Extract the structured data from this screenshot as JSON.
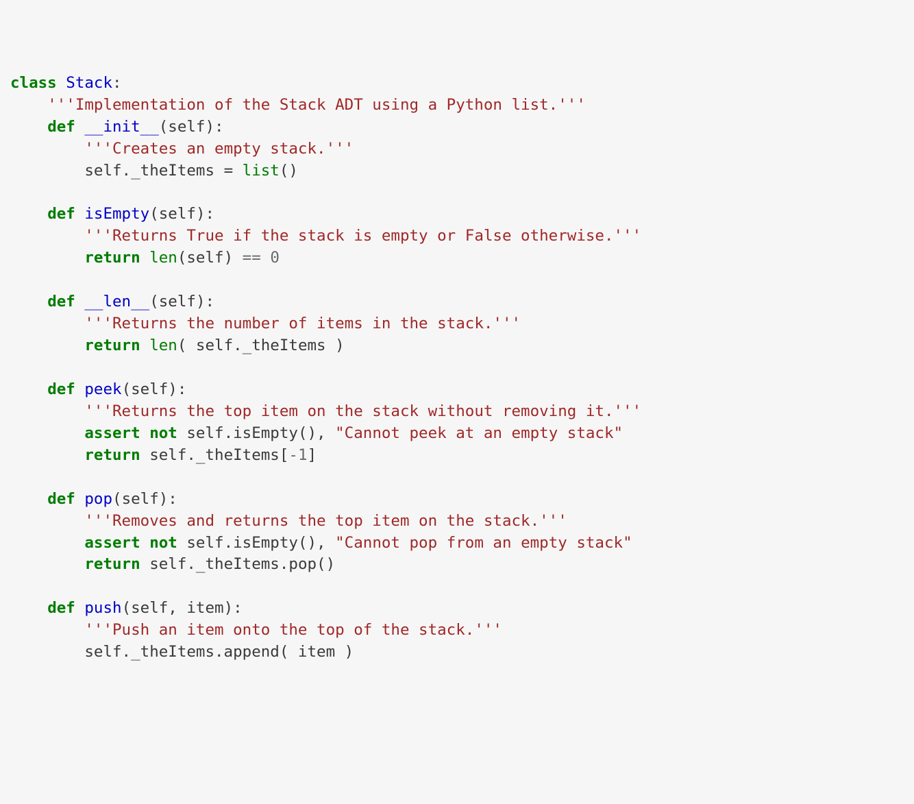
{
  "code": {
    "lines": [
      [
        {
          "cls": "kw",
          "t": "class"
        },
        {
          "cls": "id",
          "t": " "
        },
        {
          "cls": "cls",
          "t": "Stack"
        },
        {
          "cls": "pun",
          "t": ":"
        }
      ],
      [
        {
          "cls": "id",
          "t": "    "
        },
        {
          "cls": "str",
          "t": "'''Implementation of the Stack ADT using a Python list.'''"
        }
      ],
      [
        {
          "cls": "id",
          "t": "    "
        },
        {
          "cls": "kw",
          "t": "def"
        },
        {
          "cls": "id",
          "t": " "
        },
        {
          "cls": "fn",
          "t": "__init__"
        },
        {
          "cls": "pun",
          "t": "("
        },
        {
          "cls": "id",
          "t": "self"
        },
        {
          "cls": "pun",
          "t": "):"
        }
      ],
      [
        {
          "cls": "id",
          "t": "        "
        },
        {
          "cls": "str",
          "t": "'''Creates an empty stack.'''"
        }
      ],
      [
        {
          "cls": "id",
          "t": "        self._theItems "
        },
        {
          "cls": "pun",
          "t": "="
        },
        {
          "cls": "id",
          "t": " "
        },
        {
          "cls": "bi",
          "t": "list"
        },
        {
          "cls": "pun",
          "t": "()"
        }
      ],
      [
        {
          "cls": "id",
          "t": ""
        }
      ],
      [
        {
          "cls": "id",
          "t": "    "
        },
        {
          "cls": "kw",
          "t": "def"
        },
        {
          "cls": "id",
          "t": " "
        },
        {
          "cls": "fn",
          "t": "isEmpty"
        },
        {
          "cls": "pun",
          "t": "("
        },
        {
          "cls": "id",
          "t": "self"
        },
        {
          "cls": "pun",
          "t": "):"
        }
      ],
      [
        {
          "cls": "id",
          "t": "        "
        },
        {
          "cls": "str",
          "t": "'''Returns True if the stack is empty or False otherwise.'''"
        }
      ],
      [
        {
          "cls": "id",
          "t": "        "
        },
        {
          "cls": "kw",
          "t": "return"
        },
        {
          "cls": "id",
          "t": " "
        },
        {
          "cls": "bi",
          "t": "len"
        },
        {
          "cls": "pun",
          "t": "("
        },
        {
          "cls": "id",
          "t": "self"
        },
        {
          "cls": "pun",
          "t": ") "
        },
        {
          "cls": "op",
          "t": "=="
        },
        {
          "cls": "id",
          "t": " "
        },
        {
          "cls": "num",
          "t": "0"
        }
      ],
      [
        {
          "cls": "id",
          "t": ""
        }
      ],
      [
        {
          "cls": "id",
          "t": "    "
        },
        {
          "cls": "kw",
          "t": "def"
        },
        {
          "cls": "id",
          "t": " "
        },
        {
          "cls": "fn",
          "t": "__len__"
        },
        {
          "cls": "pun",
          "t": "("
        },
        {
          "cls": "id",
          "t": "self"
        },
        {
          "cls": "pun",
          "t": "):"
        }
      ],
      [
        {
          "cls": "id",
          "t": "        "
        },
        {
          "cls": "str",
          "t": "'''Returns the number of items in the stack.'''"
        }
      ],
      [
        {
          "cls": "id",
          "t": "        "
        },
        {
          "cls": "kw",
          "t": "return"
        },
        {
          "cls": "id",
          "t": " "
        },
        {
          "cls": "bi",
          "t": "len"
        },
        {
          "cls": "pun",
          "t": "("
        },
        {
          "cls": "id",
          "t": " self._theItems "
        },
        {
          "cls": "pun",
          "t": ")"
        }
      ],
      [
        {
          "cls": "id",
          "t": ""
        }
      ],
      [
        {
          "cls": "id",
          "t": "    "
        },
        {
          "cls": "kw",
          "t": "def"
        },
        {
          "cls": "id",
          "t": " "
        },
        {
          "cls": "fn",
          "t": "peek"
        },
        {
          "cls": "pun",
          "t": "("
        },
        {
          "cls": "id",
          "t": "self"
        },
        {
          "cls": "pun",
          "t": "):"
        }
      ],
      [
        {
          "cls": "id",
          "t": "        "
        },
        {
          "cls": "str",
          "t": "'''Returns the top item on the stack without removing it.'''"
        }
      ],
      [
        {
          "cls": "id",
          "t": "        "
        },
        {
          "cls": "kw",
          "t": "assert"
        },
        {
          "cls": "id",
          "t": " "
        },
        {
          "cls": "kw",
          "t": "not"
        },
        {
          "cls": "id",
          "t": " self.isEmpty"
        },
        {
          "cls": "pun",
          "t": "(), "
        },
        {
          "cls": "str",
          "t": "\"Cannot peek at an empty stack\""
        }
      ],
      [
        {
          "cls": "id",
          "t": "        "
        },
        {
          "cls": "kw",
          "t": "return"
        },
        {
          "cls": "id",
          "t": " self._theItems"
        },
        {
          "cls": "pun",
          "t": "["
        },
        {
          "cls": "op",
          "t": "-"
        },
        {
          "cls": "num",
          "t": "1"
        },
        {
          "cls": "pun",
          "t": "]"
        }
      ],
      [
        {
          "cls": "id",
          "t": ""
        }
      ],
      [
        {
          "cls": "id",
          "t": "    "
        },
        {
          "cls": "kw",
          "t": "def"
        },
        {
          "cls": "id",
          "t": " "
        },
        {
          "cls": "fn",
          "t": "pop"
        },
        {
          "cls": "pun",
          "t": "("
        },
        {
          "cls": "id",
          "t": "self"
        },
        {
          "cls": "pun",
          "t": "):"
        }
      ],
      [
        {
          "cls": "id",
          "t": "        "
        },
        {
          "cls": "str",
          "t": "'''Removes and returns the top item on the stack.'''"
        }
      ],
      [
        {
          "cls": "id",
          "t": "        "
        },
        {
          "cls": "kw",
          "t": "assert"
        },
        {
          "cls": "id",
          "t": " "
        },
        {
          "cls": "kw",
          "t": "not"
        },
        {
          "cls": "id",
          "t": " self.isEmpty"
        },
        {
          "cls": "pun",
          "t": "(), "
        },
        {
          "cls": "str",
          "t": "\"Cannot pop from an empty stack\""
        }
      ],
      [
        {
          "cls": "id",
          "t": "        "
        },
        {
          "cls": "kw",
          "t": "return"
        },
        {
          "cls": "id",
          "t": " self._theItems.pop"
        },
        {
          "cls": "pun",
          "t": "()"
        }
      ],
      [
        {
          "cls": "id",
          "t": ""
        }
      ],
      [
        {
          "cls": "id",
          "t": "    "
        },
        {
          "cls": "kw",
          "t": "def"
        },
        {
          "cls": "id",
          "t": " "
        },
        {
          "cls": "fn",
          "t": "push"
        },
        {
          "cls": "pun",
          "t": "("
        },
        {
          "cls": "id",
          "t": "self"
        },
        {
          "cls": "pun",
          "t": ", "
        },
        {
          "cls": "id",
          "t": "item"
        },
        {
          "cls": "pun",
          "t": "):"
        }
      ],
      [
        {
          "cls": "id",
          "t": "        "
        },
        {
          "cls": "str",
          "t": "'''Push an item onto the top of the stack.'''"
        }
      ],
      [
        {
          "cls": "id",
          "t": "        self._theItems.append"
        },
        {
          "cls": "pun",
          "t": "("
        },
        {
          "cls": "id",
          "t": " item "
        },
        {
          "cls": "pun",
          "t": ")"
        }
      ]
    ]
  }
}
